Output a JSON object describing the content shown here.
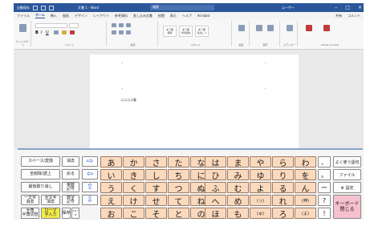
{
  "titlebar": {
    "app_label": "自動保存",
    "file_name": "文書 1 - Word",
    "search_placeholder": "検索",
    "user": "ユーザー"
  },
  "menu": {
    "tabs": [
      "ファイル",
      "ホーム",
      "挿入",
      "描画",
      "デザイン",
      "レイアウト",
      "参考資料",
      "差し込み文書",
      "校閲",
      "表示",
      "ヘルプ",
      "Acrobat"
    ],
    "active_index": 1,
    "share": "共有",
    "comments": "コメント"
  },
  "ribbon": {
    "groups": [
      "クリップボード",
      "フォント",
      "段落",
      "スタイル",
      "編集",
      "音声",
      "エディター",
      "Adobe Acrobat"
    ],
    "styles": [
      "あア亜",
      "あア亜",
      "あア亜"
    ],
    "style_names": [
      "標準",
      "行間詰め",
      "見出し 1"
    ]
  },
  "document": {
    "text": "ぶぶぶぶ春"
  },
  "keyboard": {
    "functions": [
      [
        "スペース/変換",
        "消去"
      ],
      [
        "全削除/読上",
        "戻る"
      ],
      [
        "最後取り消し",
        "英数\n記号"
      ],
      [
        "一文字\n消去",
        "全文字\n消去",
        "数字\n記号"
      ],
      [
        "全角\n半角切替",
        "ローマ\n字入力",
        "保存",
        "スキー\nマ"
      ]
    ],
    "arrows": [
      "⇨",
      "⇦",
      "⇧",
      "⇩"
    ],
    "kana_left": [
      [
        "あ",
        "か",
        "さ",
        "た",
        "な"
      ],
      [
        "い",
        "き",
        "し",
        "ち",
        "に"
      ],
      [
        "う",
        "く",
        "す",
        "つ",
        "ぬ"
      ],
      [
        "え",
        "け",
        "せ",
        "て",
        "ね"
      ],
      [
        "お",
        "こ",
        "そ",
        "と",
        "の"
      ]
    ],
    "kana_right": [
      [
        "は",
        "ま",
        "や",
        "ら",
        "わ"
      ],
      [
        "ひ",
        "み",
        "ゆ",
        "り",
        "を"
      ],
      [
        "ふ",
        "む",
        "よ",
        "る",
        "ん"
      ],
      [
        "へ",
        "め",
        "(っ)",
        "れ",
        "(伸)"
      ],
      [
        "ほ",
        "も",
        "(ゅ)",
        "ろ",
        "(よ)"
      ]
    ],
    "symbols": [
      "、",
      "。",
      "ー",
      "?",
      "!"
    ],
    "side_buttons": [
      "よく使う語句",
      "ファイル",
      "⚙ 設定"
    ],
    "close_button": "キーボード\n閉じる"
  }
}
